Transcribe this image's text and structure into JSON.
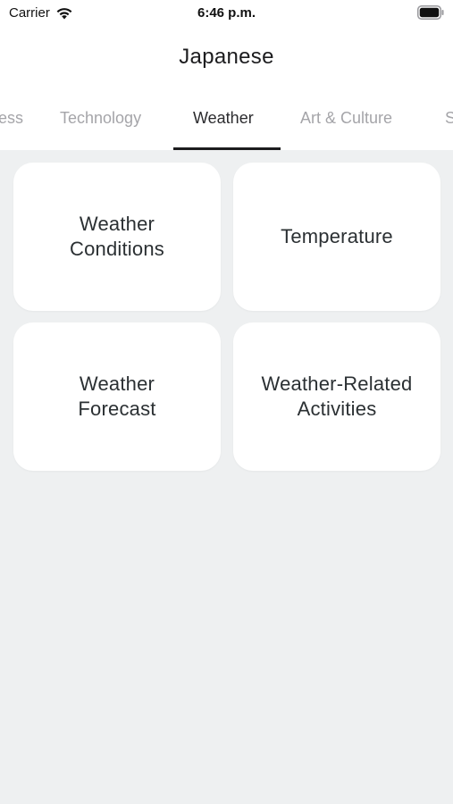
{
  "status_bar": {
    "carrier": "Carrier",
    "time": "6:46 p.m.",
    "wifi_icon": "wifi-icon",
    "battery_icon": "battery-icon"
  },
  "header": {
    "title": "Japanese"
  },
  "tabs": {
    "items": [
      {
        "label": "ess"
      },
      {
        "label": "Technology"
      },
      {
        "label": "Weather",
        "active": true
      },
      {
        "label": "Art & Culture"
      },
      {
        "label": "S"
      }
    ]
  },
  "cards": [
    {
      "label": "Weather\nConditions"
    },
    {
      "label": "Temperature"
    },
    {
      "label": "Weather\nForecast"
    },
    {
      "label": "Weather-Related\nActivities"
    }
  ],
  "colors": {
    "background": "#eef0f1",
    "card": "#ffffff",
    "tab_active": "#2b2b2e",
    "tab_inactive": "#a5a5a9",
    "indicator": "#1c1c1e"
  }
}
